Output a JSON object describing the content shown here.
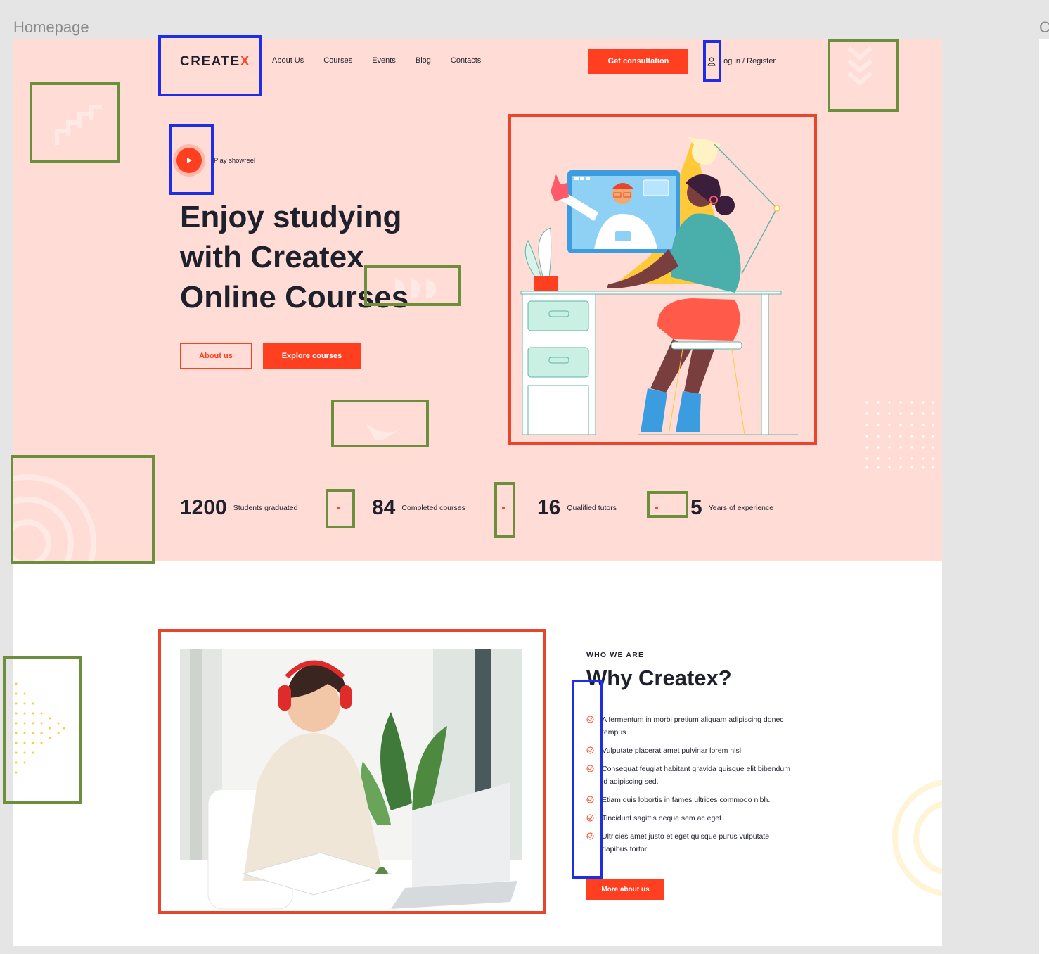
{
  "frame": {
    "title": "Homepage",
    "second_title": "C"
  },
  "header": {
    "logo_main": "CREATE",
    "logo_x": "X",
    "nav": [
      "About Us",
      "Courses",
      "Events",
      "Blog",
      "Contacts"
    ],
    "consult_label": "Get consultation",
    "login_label": "Log in / Register"
  },
  "hero": {
    "play_label": "Play showreel",
    "title_line1": "Enjoy studying",
    "title_line2": "with Createx",
    "title_line3": "Online Courses",
    "about_label": "About us",
    "explore_label": "Explore courses"
  },
  "stats": [
    {
      "number": "1200",
      "label": "Students graduated"
    },
    {
      "number": "84",
      "label": "Completed courses"
    },
    {
      "number": "16",
      "label": "Qualified tutors"
    },
    {
      "number": "5",
      "label": "Years of experience"
    }
  ],
  "why": {
    "eyebrow": "WHO WE ARE",
    "title": "Why Createx?",
    "items": [
      "A fermentum in morbi pretium aliquam adipiscing donec tempus.",
      "Vulputate placerat amet pulvinar lorem nisl.",
      "Consequat feugiat habitant gravida quisque elit bibendum id adipiscing sed.",
      "Etiam duis lobortis in fames ultrices commodo nibh.",
      "Tincidunt sagittis neque sem ac eget.",
      "Ultricies amet justo et eget quisque purus vulputate dapibus tortor."
    ],
    "more_label": "More about us"
  },
  "colors": {
    "accent": "#ff3f1f",
    "hero_bg": "#ffddd6",
    "text": "#1e212c",
    "annotation_blue": "#1d2ee6",
    "annotation_green": "#6b8f3a",
    "annotation_red": "#e8452c"
  }
}
